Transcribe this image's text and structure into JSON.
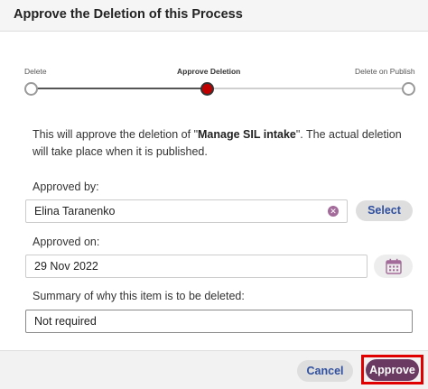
{
  "dialog": {
    "title": "Approve the Deletion of this Process"
  },
  "stepper": {
    "steps": [
      {
        "label": "Delete",
        "state": "done"
      },
      {
        "label": "Approve Deletion",
        "state": "current"
      },
      {
        "label": "Delete on Publish",
        "state": "pending"
      }
    ],
    "current_index": 1
  },
  "message": {
    "prefix": "This will approve the deletion of \"",
    "item_name": "Manage SIL intake",
    "suffix": "\". The actual deletion will take place when it is published."
  },
  "approved_by": {
    "label": "Approved by:",
    "value": "Elina Taranenko",
    "select_label": "Select",
    "clear_icon": "close-circle-icon"
  },
  "approved_on": {
    "label": "Approved on:",
    "value": "29 Nov 2022",
    "calendar_icon": "calendar-icon"
  },
  "summary": {
    "label": "Summary of why this item is to be deleted:",
    "value": "Not required"
  },
  "footer": {
    "cancel_label": "Cancel",
    "approve_label": "Approve"
  },
  "colors": {
    "accent": "#6b3a63",
    "link_text": "#2f4f9f",
    "current_step": "#c00000",
    "highlight": "#e00000"
  }
}
